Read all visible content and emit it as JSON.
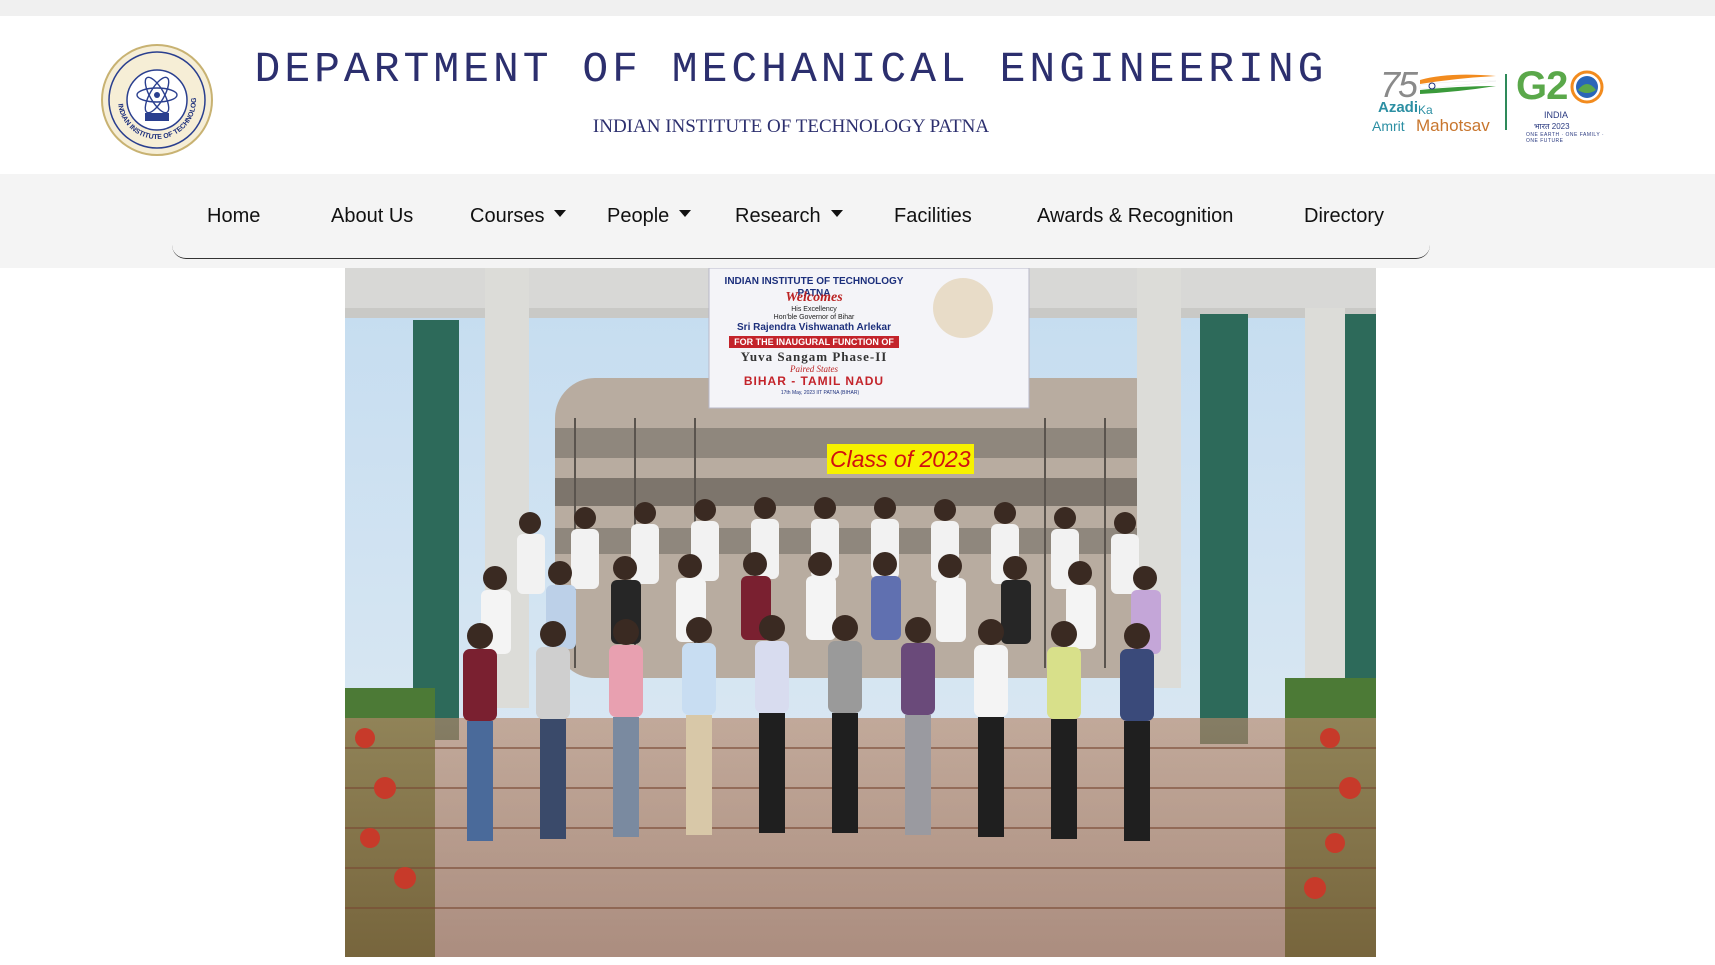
{
  "header": {
    "department": "DEPARTMENT OF MECHANICAL ENGINEERING",
    "institute": "INDIAN INSTITUTE OF TECHNOLOGY PATNA",
    "logo_icon": "iit-patna-emblem-icon",
    "logo_ring_text": "INDIAN INSTITUTE OF TECHNOLOGY PATNA",
    "azadi_logo": {
      "number": "75",
      "line1": "Azadi",
      "ka": "Ka",
      "line2": "Amrit",
      "mahotsav": "Mahotsav"
    },
    "g20_logo": {
      "text": "G2",
      "sub": "INDIA",
      "hindi": "भारत 2023",
      "motto": "ONE EARTH · ONE FAMILY · ONE FUTURE"
    }
  },
  "nav": {
    "items": [
      {
        "label": "Home",
        "dropdown": false
      },
      {
        "label": "About Us",
        "dropdown": false
      },
      {
        "label": "Courses",
        "dropdown": true
      },
      {
        "label": "People",
        "dropdown": true
      },
      {
        "label": "Research",
        "dropdown": true
      },
      {
        "label": "Facilities",
        "dropdown": false
      },
      {
        "label": "Awards & Recognition",
        "dropdown": false
      },
      {
        "label": "Directory",
        "dropdown": false
      }
    ]
  },
  "hero": {
    "caption": "Class of 2023",
    "banner": {
      "institute": "INDIAN INSTITUTE OF TECHNOLOGY PATNA",
      "welcomes": "Welcomes",
      "excellency": "His Excellency",
      "governor": "Hon'ble Governor of Bihar",
      "name": "Sri Rajendra Vishwanath Arlekar",
      "event": "FOR THE INAUGURAL FUNCTION OF",
      "program": "Yuva Sangam Phase-II",
      "paired": "Paired States",
      "states": "BIHAR - TAMIL NADU",
      "footer": "17th May, 2023      IIT PATNA (BIHAR)"
    }
  },
  "colors": {
    "title_blue": "#2c2f6e",
    "nav_band": "#f4f4f4",
    "caption_bg": "#f7f200",
    "caption_text": "#d11010"
  }
}
